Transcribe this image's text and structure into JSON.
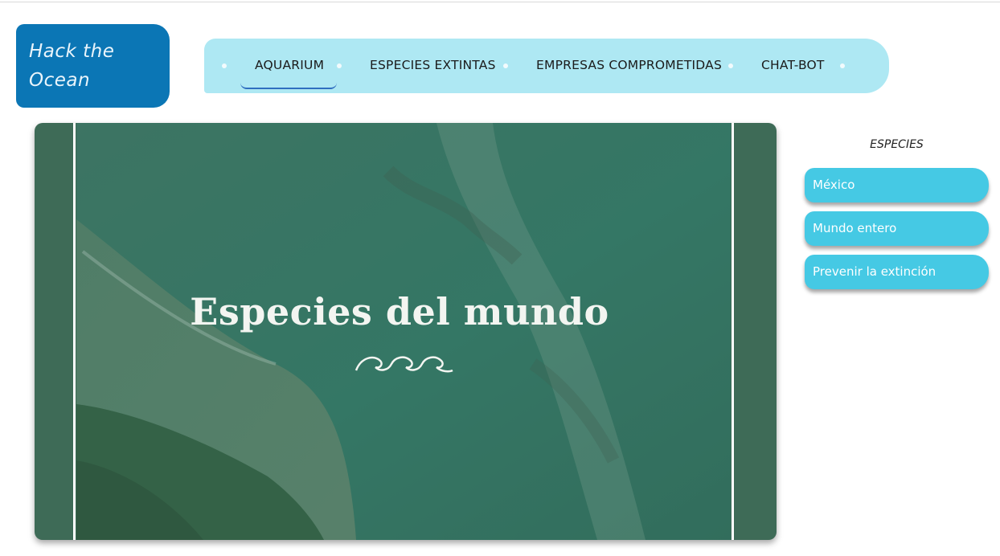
{
  "logo": {
    "line1": "Hack the",
    "line2": "Ocean"
  },
  "nav": {
    "items": [
      {
        "label": "AQUARIUM",
        "active": true
      },
      {
        "label": "ESPECIES EXTINTAS",
        "active": false
      },
      {
        "label": "EMPRESAS COMPROMETIDAS",
        "active": false
      },
      {
        "label": "CHAT-BOT",
        "active": false
      }
    ]
  },
  "hero": {
    "title": "Especies del mundo",
    "icon": "waves-icon"
  },
  "sidebar": {
    "title": "ESPECIES",
    "buttons": [
      {
        "label": "México"
      },
      {
        "label": "Mundo entero"
      },
      {
        "label": "Prevenir la extinción"
      }
    ]
  },
  "colors": {
    "logo_bg": "#0b76b5",
    "nav_bg": "#aee8f3",
    "button_bg": "#45c9e4",
    "hero_frame": "#3e6b57",
    "active_underline": "#2f6fc0"
  }
}
